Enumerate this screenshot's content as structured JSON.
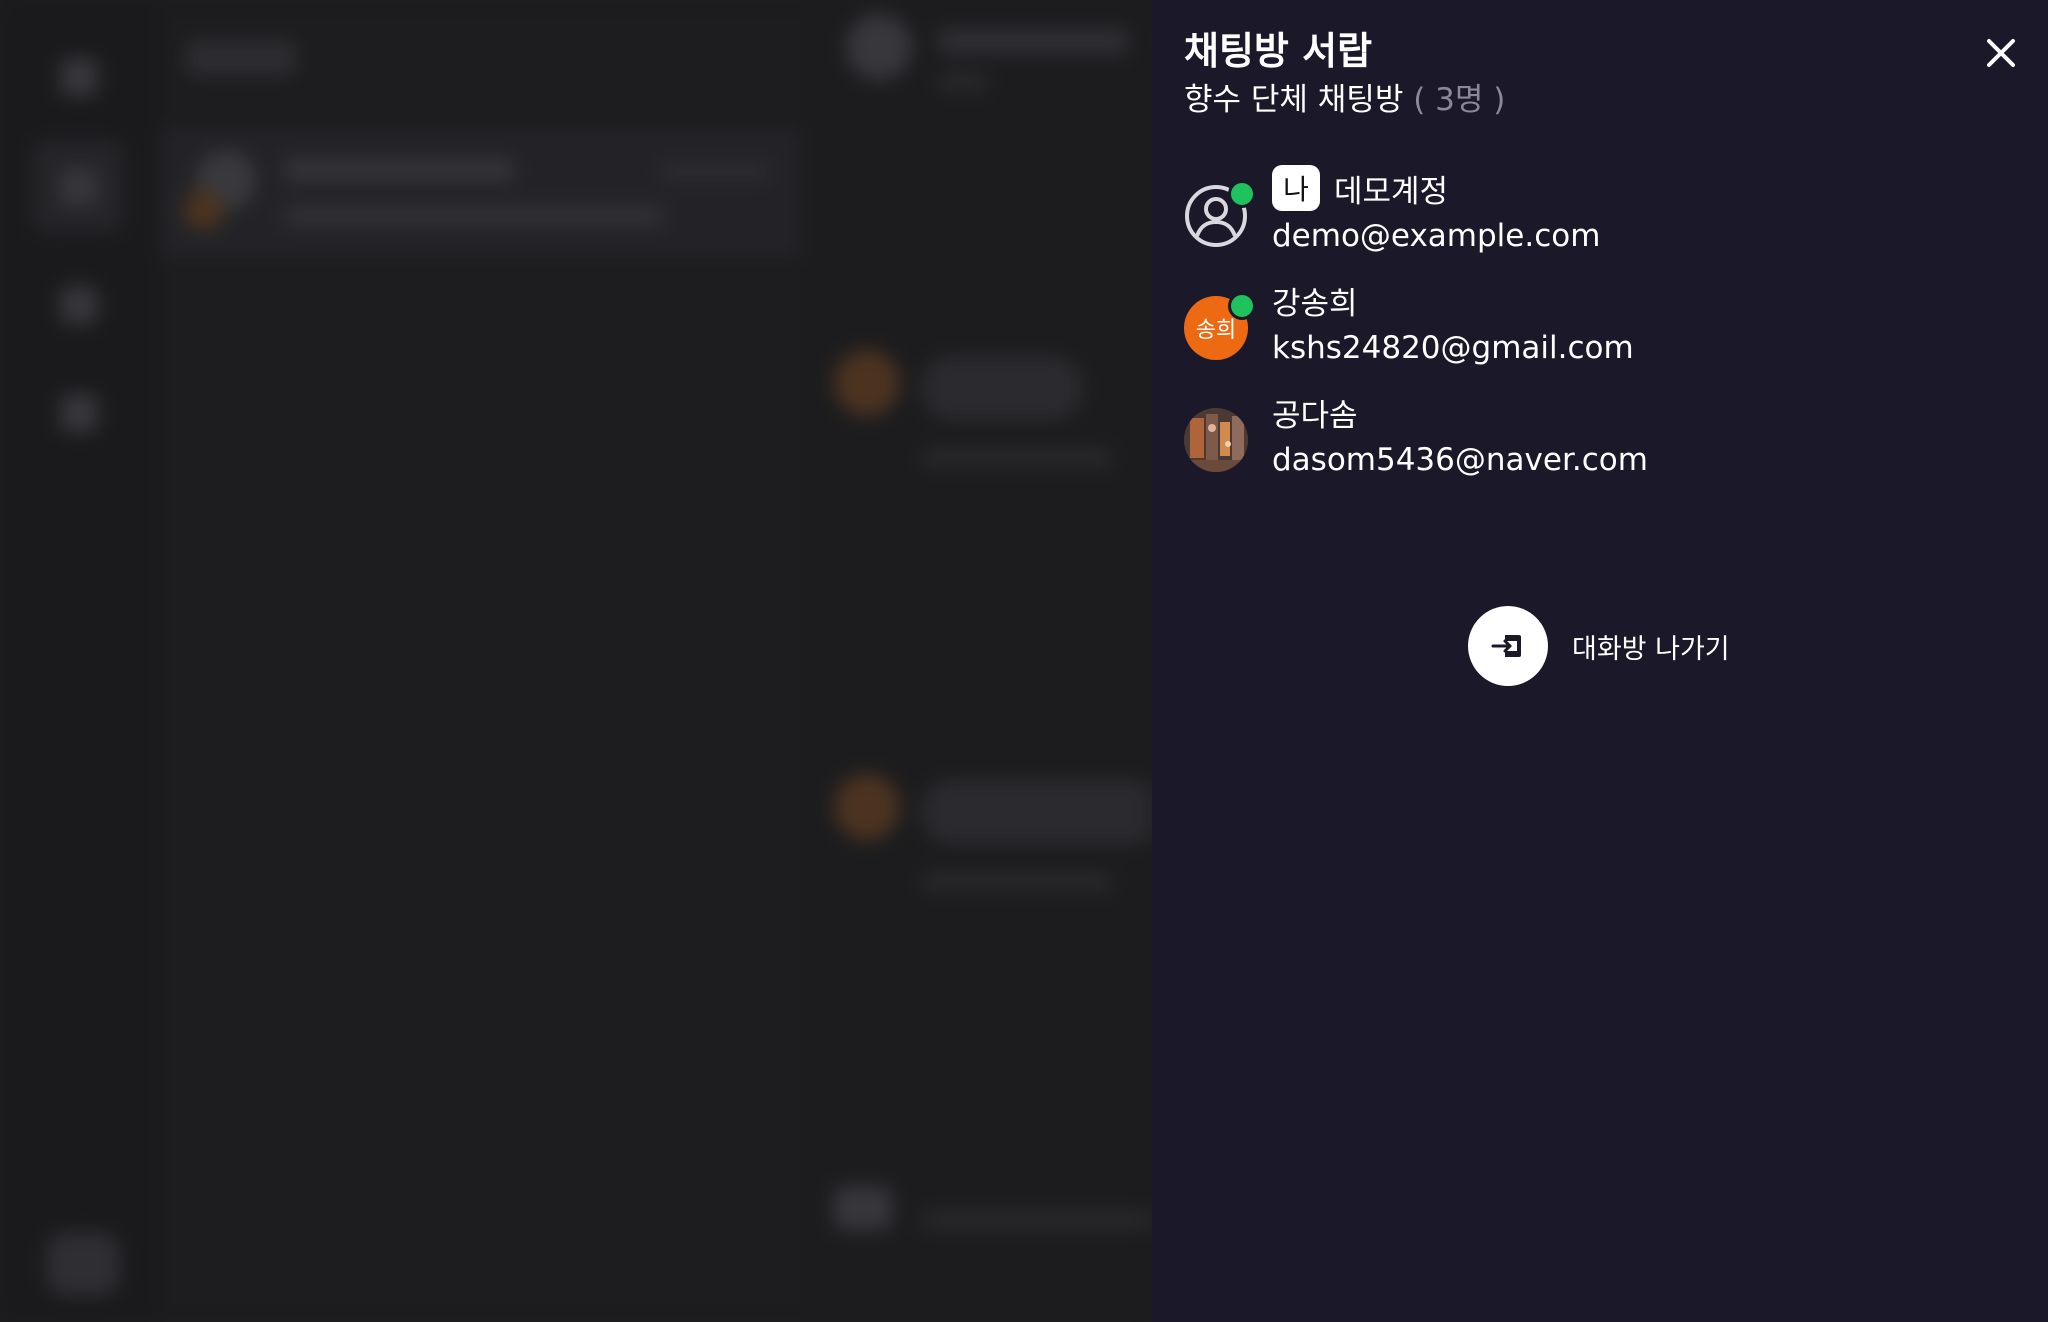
{
  "drawer": {
    "title": "채팅방 서랍",
    "room_name": "향수 단체 채팅방",
    "member_count": "( 3명 )",
    "close_icon": "close-icon",
    "members": [
      {
        "name": "데모계정",
        "email": "demo@example.com",
        "is_me": true,
        "me_badge": "나",
        "online": true,
        "avatar_type": "default-user-icon"
      },
      {
        "name": "강송희",
        "email": "kshs24820@gmail.com",
        "is_me": false,
        "online": true,
        "avatar_type": "initials",
        "avatar_initials": "송희",
        "avatar_color": "#ee6a12"
      },
      {
        "name": "공다솜",
        "email": "dasom5436@naver.com",
        "is_me": false,
        "online": false,
        "avatar_type": "photo"
      }
    ],
    "leave_button": {
      "label": "대화방 나가기",
      "icon": "exit-icon"
    }
  },
  "colors": {
    "drawer_bg": "#1a1829",
    "online": "#1fc25c",
    "accent_orange": "#ee6a12",
    "muted": "#8a8899"
  }
}
